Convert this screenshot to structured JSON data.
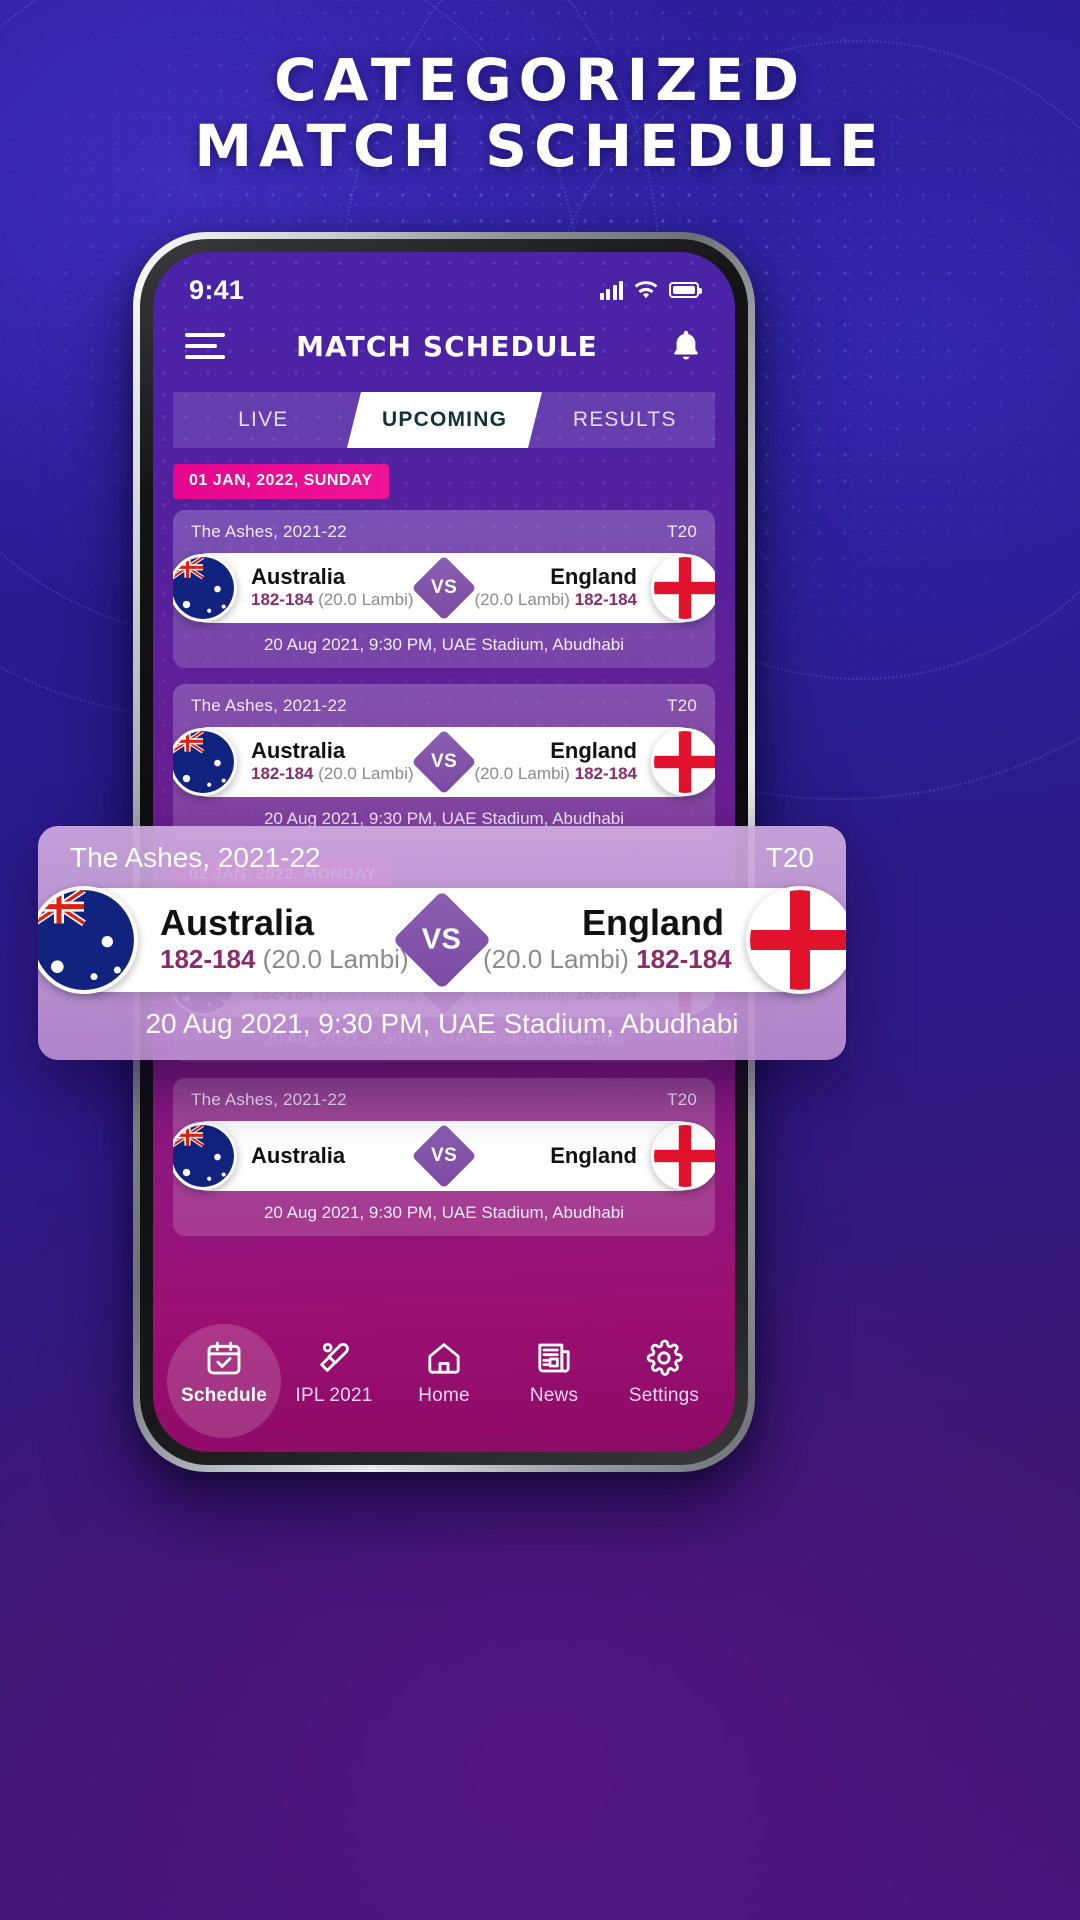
{
  "headline": {
    "line1": "CATEGORIZED",
    "line2": "MATCH SCHEDULE"
  },
  "status_bar": {
    "time": "9:41"
  },
  "app_bar": {
    "title": "MATCH SCHEDULE",
    "menu_icon": "hamburger-menu-icon",
    "notification_icon": "bell-icon"
  },
  "tabs": [
    {
      "label": "LIVE",
      "active": false
    },
    {
      "label": "UPCOMING",
      "active": true
    },
    {
      "label": "RESULTS",
      "active": false
    }
  ],
  "groups": [
    {
      "date": "01 JAN, 2022, SUNDAY",
      "matches": [
        {
          "league": "The Ashes, 2021-22",
          "format": "T20",
          "team_left": {
            "name": "Australia",
            "score": "182-184",
            "overs": "(20.0 Lambi)",
            "flag": "australia-flag-icon"
          },
          "team_right": {
            "name": "England",
            "score": "182-184",
            "overs": "(20.0 Lambi)",
            "flag": "england-flag-icon"
          },
          "vs": "VS",
          "venue": "20 Aug 2021, 9:30 PM, UAE Stadium, Abudhabi"
        },
        {
          "league": "The Ashes, 2021-22",
          "format": "T20",
          "team_left": {
            "name": "Australia",
            "score": "182-184",
            "overs": "(20.0 Lambi)",
            "flag": "australia-flag-icon"
          },
          "team_right": {
            "name": "England",
            "score": "182-184",
            "overs": "(20.0 Lambi)",
            "flag": "england-flag-icon"
          },
          "vs": "VS",
          "venue": "20 Aug 2021, 9:30 PM, UAE Stadium, Abudhabi"
        }
      ]
    },
    {
      "date": "02 JAN, 2022, MONDAY",
      "matches": [
        {
          "league": "The Ashes, 2021-22",
          "format": "T20",
          "team_left": {
            "name": "Australia",
            "score": "182-184",
            "overs": "(20.0 Lambi)",
            "flag": "australia-flag-icon"
          },
          "team_right": {
            "name": "England",
            "score": "182-184",
            "overs": "(20.0 Lambi)",
            "flag": "england-flag-icon"
          },
          "vs": "VS",
          "venue": "20 Aug 2021, 9:30 PM, UAE Stadium, Abudhabi"
        },
        {
          "league": "The Ashes, 2021-22",
          "format": "T20",
          "team_left": {
            "name": "Australia",
            "score": "",
            "overs": "",
            "flag": "australia-flag-icon"
          },
          "team_right": {
            "name": "England",
            "score": "",
            "overs": "",
            "flag": "england-flag-icon"
          },
          "vs": "VS",
          "venue": "20 Aug 2021, 9:30 PM, UAE Stadium, Abudhabi"
        }
      ]
    }
  ],
  "featured": {
    "league": "The Ashes, 2021-22",
    "format": "T20",
    "team_left": {
      "name": "Australia",
      "score": "182-184",
      "overs": "(20.0 Lambi)",
      "flag": "australia-flag-icon"
    },
    "team_right": {
      "name": "England",
      "score": "182-184",
      "overs": "(20.0 Lambi)",
      "flag": "england-flag-icon"
    },
    "vs": "VS",
    "venue": "20 Aug 2021, 9:30 PM, UAE Stadium, Abudhabi"
  },
  "bottom_nav": [
    {
      "label": "Schedule",
      "icon": "calendar-check-icon",
      "active": true
    },
    {
      "label": "IPL 2021",
      "icon": "cricket-bat-ball-icon",
      "active": false
    },
    {
      "label": "Home",
      "icon": "home-icon",
      "active": false
    },
    {
      "label": "News",
      "icon": "newspaper-icon",
      "active": false
    },
    {
      "label": "Settings",
      "icon": "gear-icon",
      "active": false
    }
  ],
  "colors": {
    "accent_pink": "#e5058f",
    "screen_top": "#4a23a8",
    "screen_bottom": "#8d0b66",
    "tab_active_text": "#12333a",
    "score_text": "#8a2b6d"
  }
}
